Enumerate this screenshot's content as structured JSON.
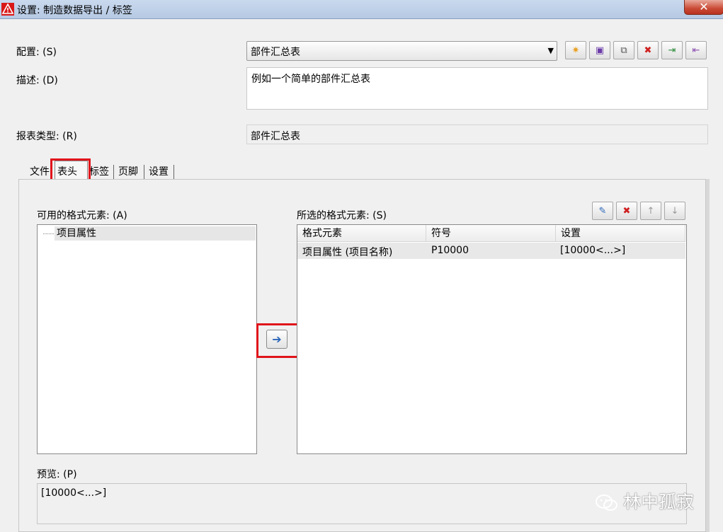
{
  "window": {
    "title": "设置: 制造数据导出 / 标签",
    "close_label": "✕"
  },
  "form": {
    "config_label": "配置: (S)",
    "config_value": "部件汇总表",
    "desc_label": "描述: (D)",
    "desc_value": "例如一个简单的部件汇总表",
    "report_type_label": "报表类型: (R)",
    "report_type_value": "部件汇总表"
  },
  "toolbar": {
    "buttons": [
      {
        "icon": "new-icon",
        "glyph": "✷",
        "color": "#e8a020"
      },
      {
        "icon": "save-icon",
        "glyph": "▣",
        "color": "#6a3aa8"
      },
      {
        "icon": "copy-icon",
        "glyph": "⧉",
        "color": "#555555"
      },
      {
        "icon": "delete-icon",
        "glyph": "✖",
        "color": "#d02020"
      },
      {
        "icon": "import-icon",
        "glyph": "⇥",
        "color": "#2e8b3a"
      },
      {
        "icon": "export-icon",
        "glyph": "⇤",
        "color": "#8a4fb0"
      }
    ]
  },
  "tabs": [
    {
      "label": "文件"
    },
    {
      "label": "表头",
      "active": true
    },
    {
      "label": "标签"
    },
    {
      "label": "页脚"
    },
    {
      "label": "设置"
    }
  ],
  "available": {
    "label": "可用的格式元素: (A)",
    "items": [
      "项目属性"
    ]
  },
  "selected": {
    "label": "所选的格式元素: (S)",
    "columns": [
      "格式元素",
      "符号",
      "设置"
    ],
    "rows": [
      [
        "项目属性 (项目名称)",
        "P10000",
        "[10000<...>]"
      ]
    ],
    "tool_icons": [
      {
        "icon": "edit-icon",
        "glyph": "✎",
        "color": "#2b66b8"
      },
      {
        "icon": "remove-icon",
        "glyph": "✖",
        "color": "#d02020"
      },
      {
        "icon": "move-up-icon",
        "glyph": "↑",
        "color": "#9a9a9a"
      },
      {
        "icon": "move-down-icon",
        "glyph": "↓",
        "color": "#9a9a9a"
      }
    ]
  },
  "transfer": {
    "glyph": "➔"
  },
  "preview": {
    "label": "预览: (P)",
    "value": "[10000<...>]"
  },
  "watermark": {
    "text": "林中孤寂"
  },
  "colors": {
    "highlight": "#e0151b"
  }
}
